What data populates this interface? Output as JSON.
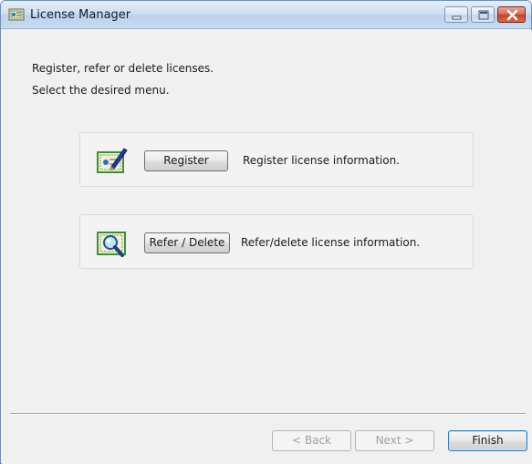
{
  "window": {
    "title": "License Manager",
    "icon": "license-manager-icon"
  },
  "caption_buttons": {
    "minimize_icon": "minimize-icon",
    "maximize_icon": "maximize-icon",
    "close_icon": "close-icon"
  },
  "intro": {
    "line1": "Register, refer or delete licenses.",
    "line2": "Select the desired menu."
  },
  "menu": [
    {
      "icon": "certificate-edit-icon",
      "button_label": "Register",
      "description": "Register license information."
    },
    {
      "icon": "certificate-search-icon",
      "button_label": "Refer / Delete",
      "description": "Refer/delete license information."
    }
  ],
  "footer": {
    "back_label": "< Back",
    "next_label": "Next >",
    "finish_label": "Finish",
    "back_enabled": false,
    "next_enabled": false
  },
  "colors": {
    "finish_border": "#3c7fb1",
    "close_button": "#c2422a",
    "certificate_green": "#3f8f3a"
  }
}
